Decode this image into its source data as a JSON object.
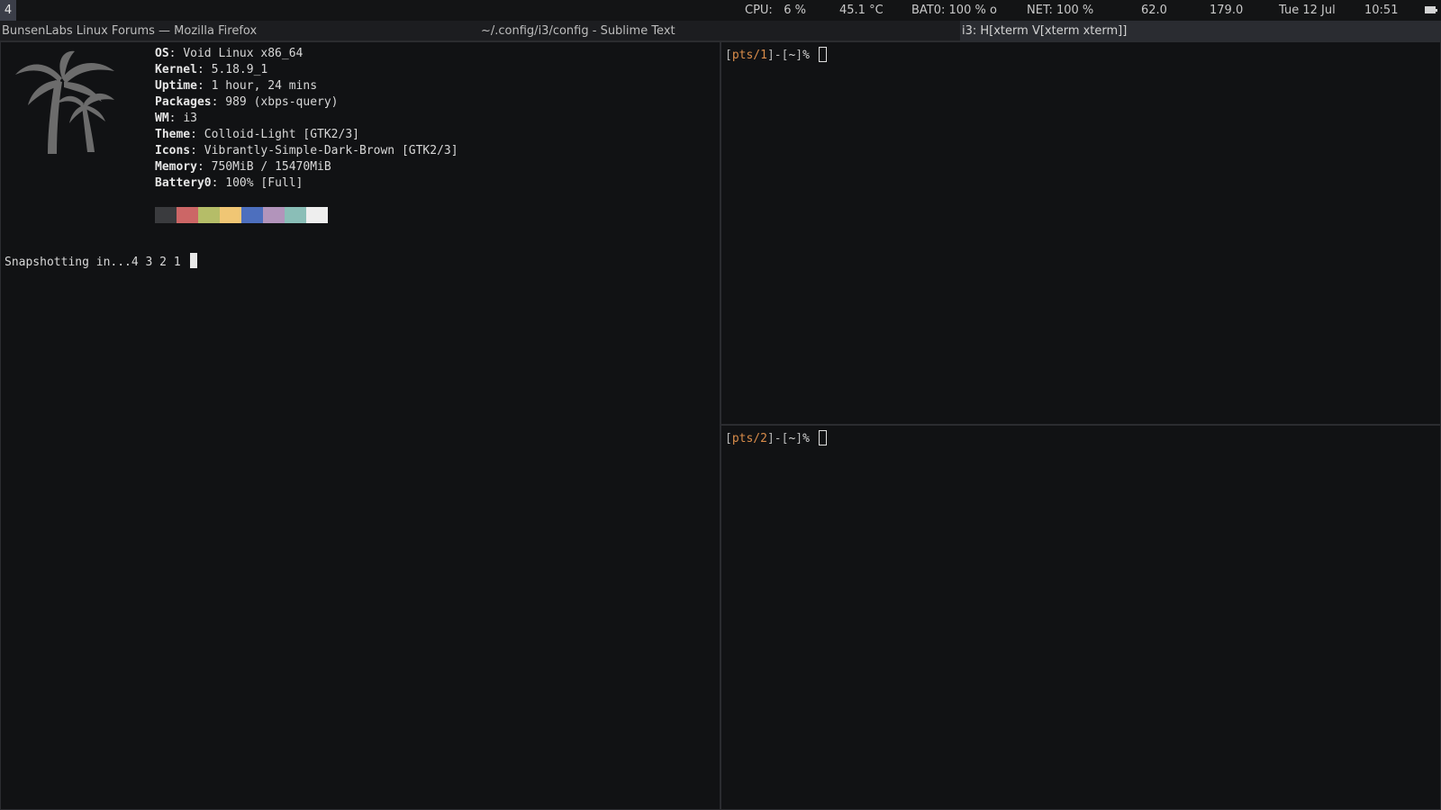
{
  "statusbar": {
    "workspace": "4",
    "cpu": "CPU:   6 %",
    "temp": "45.1 °C",
    "battery": "BAT0: 100 % o",
    "net": "NET: 100 %",
    "val1": "62.0",
    "val2": "179.0",
    "date": "Tue 12 Jul",
    "time": "10:51"
  },
  "tabs": {
    "firefox": "BunsenLabs Linux Forums — Mozilla Firefox",
    "sublime": "~/.config/i3/config - Sublime Text",
    "i3": "i3: H[xterm V[xterm xterm]]"
  },
  "fetch": {
    "lines": [
      {
        "key": "OS",
        "value": "Void Linux x86_64"
      },
      {
        "key": "Kernel",
        "value": "5.18.9_1"
      },
      {
        "key": "Uptime",
        "value": "1 hour, 24 mins"
      },
      {
        "key": "Packages",
        "value": "989 (xbps-query)"
      },
      {
        "key": "WM",
        "value": "i3"
      },
      {
        "key": "Theme",
        "value": "Colloid-Light [GTK2/3]"
      },
      {
        "key": "Icons",
        "value": "Vibrantly-Simple-Dark-Brown [GTK2/3]"
      },
      {
        "key": "Memory",
        "value": "750MiB / 15470MiB"
      },
      {
        "key": "Battery0",
        "value": "100% [Full]"
      }
    ],
    "separator": ": ",
    "palette": [
      "#3a3b3e",
      "#cc6666",
      "#b5bd68",
      "#f0c674",
      "#4d6fbe",
      "#b294bb",
      "#8abeb7",
      "#eeeeee"
    ]
  },
  "terminal_left": {
    "snapshot_text": "Snapshotting in...4 3 2 1"
  },
  "terminal_top": {
    "tty": "pts/1",
    "dir": "~",
    "symbol": "%"
  },
  "terminal_bottom": {
    "tty": "pts/2",
    "dir": "~",
    "symbol": "%"
  },
  "colors": {
    "accent_tty": "#d98c4a",
    "background": "#111214",
    "foreground": "#d8d8d8"
  }
}
